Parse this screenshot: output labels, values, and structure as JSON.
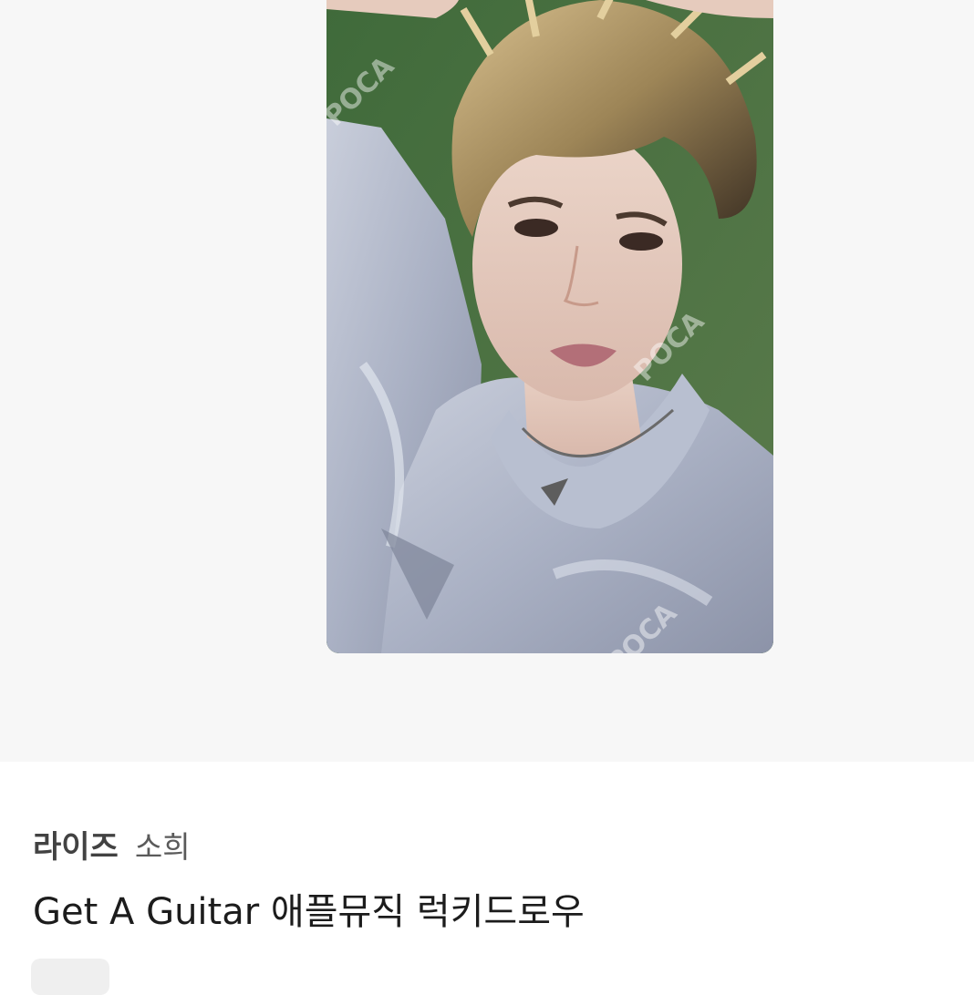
{
  "product": {
    "group": "라이즈",
    "member": "소희",
    "title": "Get A Guitar 애플뮤직 럭키드로우"
  },
  "photo": {
    "watermark": "POCA",
    "subject": "photocard-portrait"
  },
  "colors": {
    "hero_background": "#f7f7f7",
    "card_background": "#4d6d3f",
    "title_text": "#1c1c1c",
    "meta_text": "#424242"
  }
}
